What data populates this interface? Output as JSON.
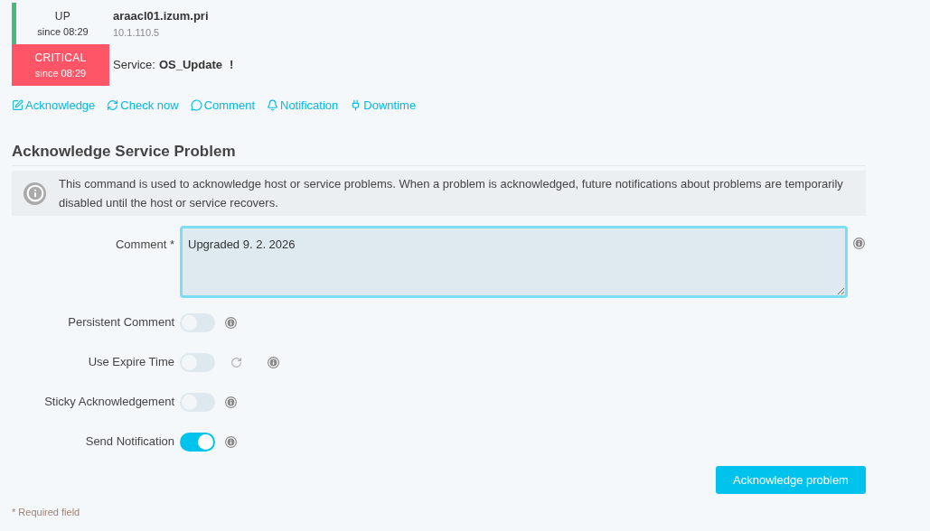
{
  "host": {
    "state": "UP",
    "since": "since 08:29",
    "name": "araacl01.izum.pri",
    "address": "10.1.110.5"
  },
  "service": {
    "state": "CRITICAL",
    "since": "since 08:29",
    "label": "Service:",
    "name": "OS_Update",
    "flag": "!"
  },
  "actions": [
    "Acknowledge",
    "Check now",
    "Comment",
    "Notification",
    "Downtime"
  ],
  "form": {
    "title": "Acknowledge Service Problem",
    "info": "This command is used to acknowledge host or service problems. When a problem is acknowledged, future notifications about problems are temporarily disabled until the host or service recovers.",
    "comment": {
      "label": "Comment *",
      "value": "Upgraded 9. 2. 2026"
    },
    "options": [
      {
        "kind": "toggle",
        "label": "Persistent Comment",
        "on": false
      },
      {
        "kind": "toggle-refresh",
        "label": "Use Expire Time",
        "on": false
      },
      {
        "kind": "toggle",
        "label": "Sticky Acknowledgement",
        "on": false
      },
      {
        "kind": "toggle",
        "label": "Send Notification",
        "on": true
      }
    ],
    "submit": "Acknowledge problem",
    "required_note": "* Required field"
  }
}
